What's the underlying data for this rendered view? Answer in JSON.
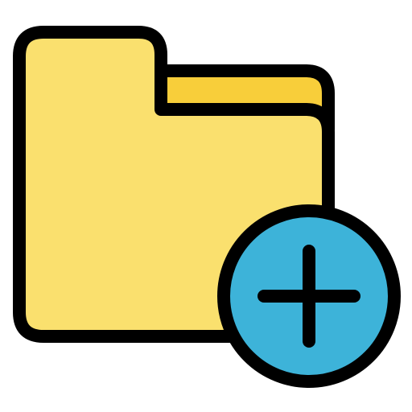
{
  "icon": {
    "name": "add-folder-icon",
    "parts": [
      "folder-icon",
      "plus-circle-icon"
    ]
  },
  "colors": {
    "background": "#ffffff",
    "outline": "#000000",
    "folder_front": "#fae06e",
    "folder_back": "#f8ce3a",
    "badge_fill": "#3db3d9"
  }
}
